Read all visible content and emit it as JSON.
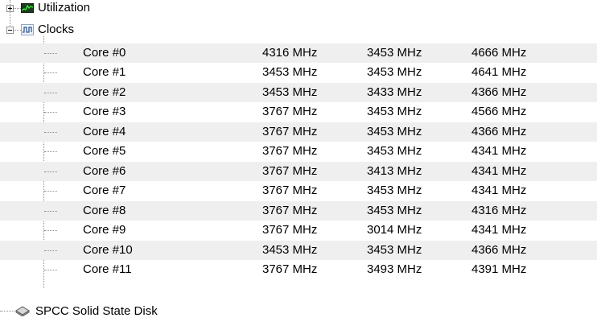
{
  "tree": {
    "utilization_label": "Utilization",
    "clocks_label": "Clocks",
    "disk_label": "SPCC Solid State Disk",
    "rows": [
      {
        "name": "Core #0",
        "v1": "4316 MHz",
        "v2": "3453 MHz",
        "v3": "4666 MHz"
      },
      {
        "name": "Core #1",
        "v1": "3453 MHz",
        "v2": "3453 MHz",
        "v3": "4641 MHz"
      },
      {
        "name": "Core #2",
        "v1": "3453 MHz",
        "v2": "3433 MHz",
        "v3": "4366 MHz"
      },
      {
        "name": "Core #3",
        "v1": "3767 MHz",
        "v2": "3453 MHz",
        "v3": "4566 MHz"
      },
      {
        "name": "Core #4",
        "v1": "3767 MHz",
        "v2": "3453 MHz",
        "v3": "4366 MHz"
      },
      {
        "name": "Core #5",
        "v1": "3767 MHz",
        "v2": "3453 MHz",
        "v3": "4341 MHz"
      },
      {
        "name": "Core #6",
        "v1": "3767 MHz",
        "v2": "3413 MHz",
        "v3": "4341 MHz"
      },
      {
        "name": "Core #7",
        "v1": "3767 MHz",
        "v2": "3453 MHz",
        "v3": "4341 MHz"
      },
      {
        "name": "Core #8",
        "v1": "3767 MHz",
        "v2": "3453 MHz",
        "v3": "4316 MHz"
      },
      {
        "name": "Core #9",
        "v1": "3767 MHz",
        "v2": "3014 MHz",
        "v3": "4341 MHz"
      },
      {
        "name": "Core #10",
        "v1": "3453 MHz",
        "v2": "3453 MHz",
        "v3": "4366 MHz"
      },
      {
        "name": "Core #11",
        "v1": "3767 MHz",
        "v2": "3493 MHz",
        "v3": "4391 MHz"
      }
    ]
  },
  "icons": {
    "utilization": "utilization-graph-icon",
    "clocks": "clock-wave-icon",
    "disk": "disk-drive-icon",
    "expand": "expand-plus-icon",
    "collapse": "collapse-minus-icon"
  }
}
